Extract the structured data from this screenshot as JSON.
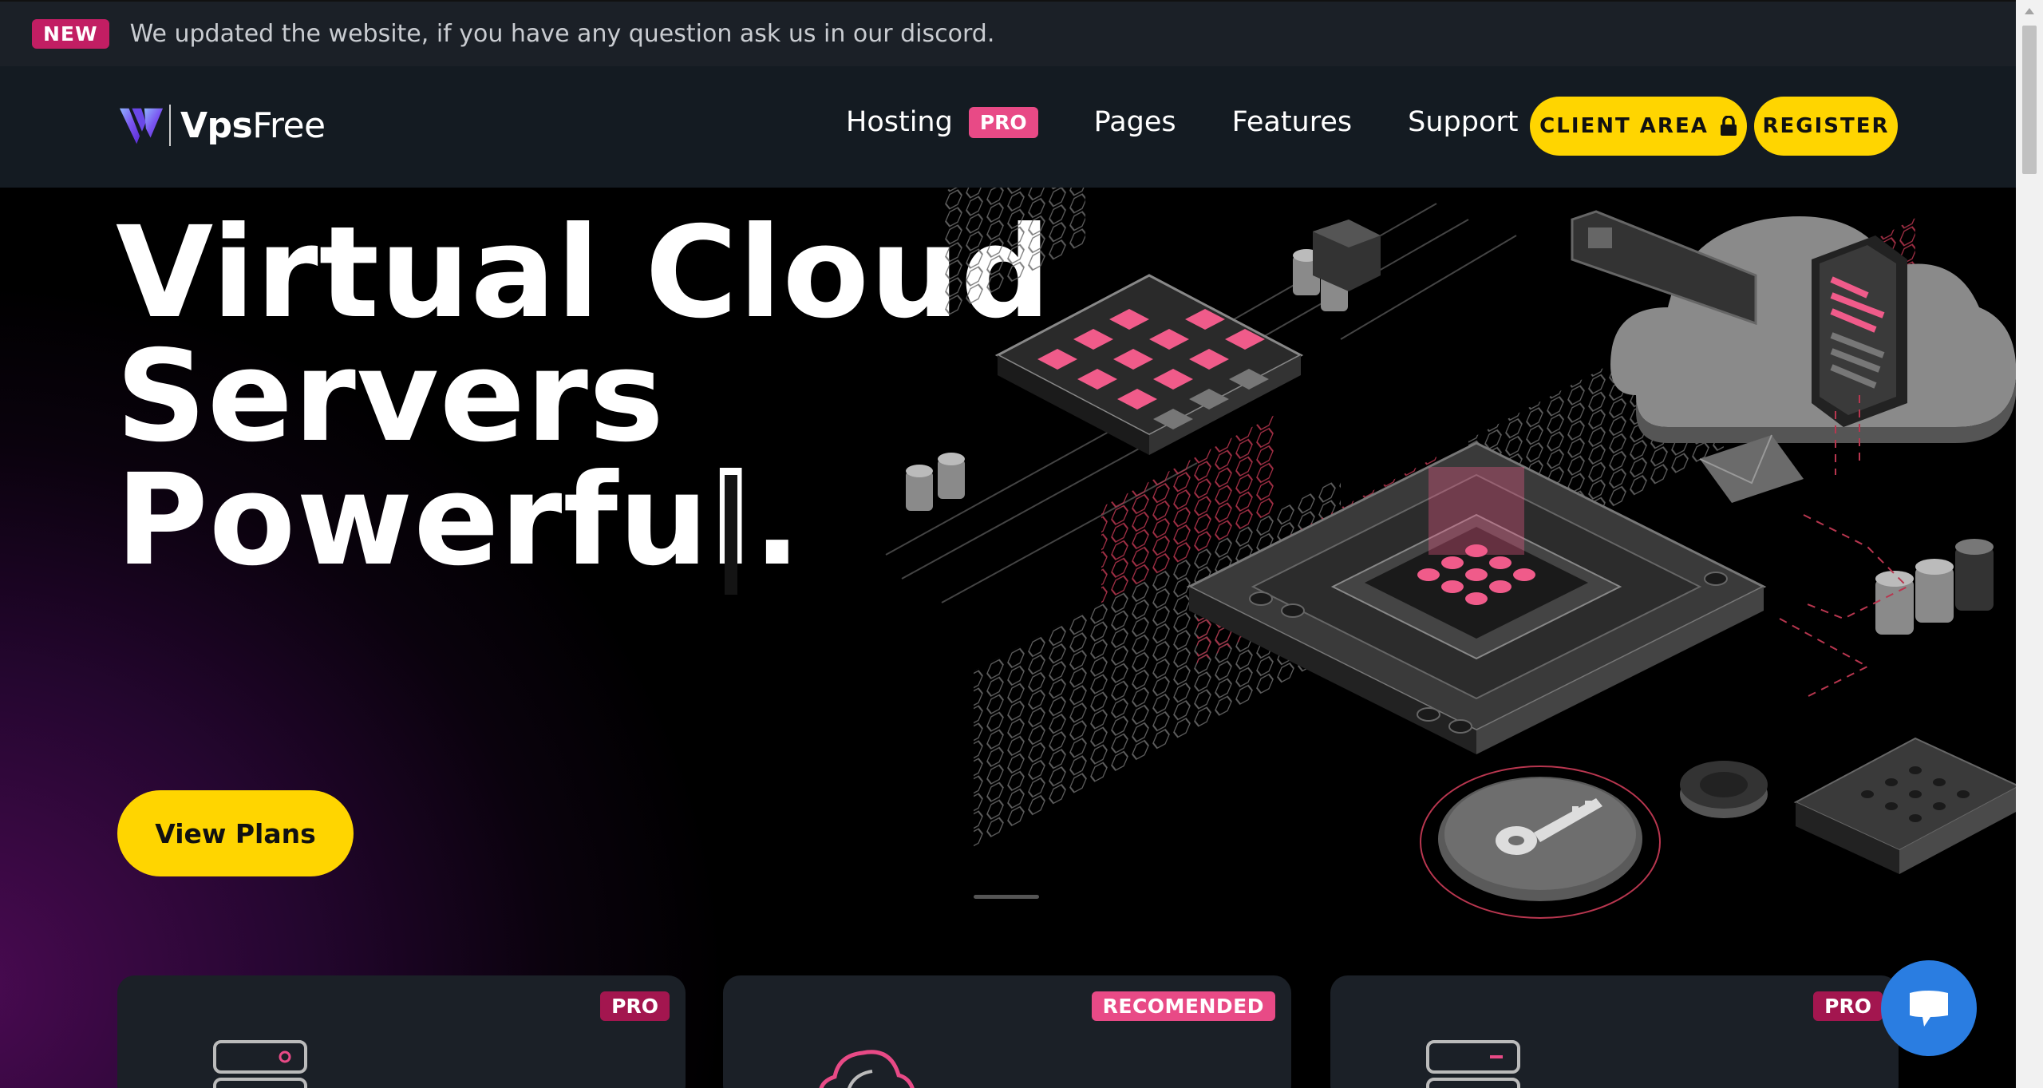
{
  "announcement": {
    "badge": "NEW",
    "message": "We updated the website, if you have any question ask us in our discord."
  },
  "brand": {
    "name_bold": "Vps",
    "name_light": "Free",
    "logo_icon": "v-logo-icon"
  },
  "nav": {
    "items": [
      {
        "label": "Hosting",
        "badge": "PRO"
      },
      {
        "label": "Pages"
      },
      {
        "label": "Features"
      },
      {
        "label": "Support"
      }
    ],
    "client_area": "CLIENT AREA",
    "register": "REGISTER"
  },
  "hero": {
    "title_lines": [
      "Virtual Cloud",
      "Servers",
      "Powerful."
    ],
    "cta": "View Plans"
  },
  "cards": [
    {
      "tag": "PRO",
      "icon": "server-icon"
    },
    {
      "tag": "RECOMENDED",
      "icon": "cloud-icon"
    },
    {
      "tag": "PRO",
      "icon": "server-icon"
    }
  ],
  "colors": {
    "accent_yellow": "#ffd500",
    "accent_pink": "#e84a86",
    "badge_magenta": "#c21e63",
    "nav_bg": "#141b22",
    "card_bg": "#1b2027",
    "chat_blue": "#2a7de1"
  },
  "chat": {
    "icon": "chat-bubble-icon"
  }
}
